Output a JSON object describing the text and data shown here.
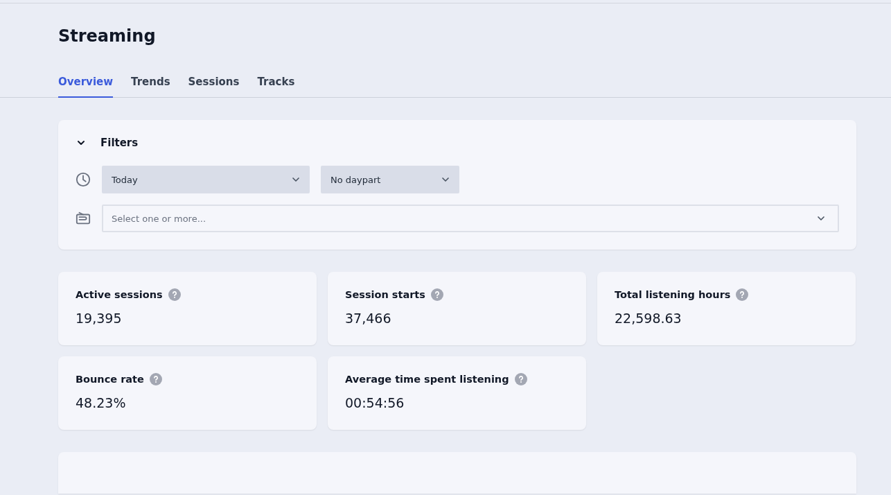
{
  "page": {
    "title": "Streaming"
  },
  "tabs": [
    {
      "label": "Overview",
      "selected": true
    },
    {
      "label": "Trends",
      "selected": false
    },
    {
      "label": "Sessions",
      "selected": false
    },
    {
      "label": "Tracks",
      "selected": false
    }
  ],
  "filters": {
    "title": "Filters",
    "expanded": true,
    "period": {
      "value": "Today"
    },
    "daypart": {
      "value": "No daypart"
    },
    "stations": {
      "placeholder": "Select one or more..."
    }
  },
  "metrics": [
    {
      "label": "Active sessions",
      "value": "19,395"
    },
    {
      "label": "Session starts",
      "value": "37,466"
    },
    {
      "label": "Total listening hours",
      "value": "22,598.63"
    },
    {
      "label": "Bounce rate",
      "value": "48.23%"
    },
    {
      "label": "Average time spent listening",
      "value": "00:54:56"
    }
  ]
}
